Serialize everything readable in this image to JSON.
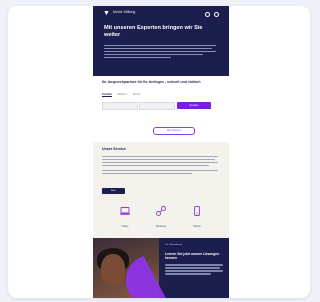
{
  "hero": {
    "title": "Mit unseren Experten bringen wir Sie weiter",
    "logo": "Moritz Stiftung"
  },
  "form": {
    "title": "Ihr Ansprechpartner für Ihr Anliegen - schnell und einfach",
    "tabs": [
      "Kontakt",
      "Rückruf",
      "Termin"
    ],
    "submit_label": "Senden",
    "more_label": "Alle Optionen"
  },
  "info": {
    "title": "Unser Service",
    "button_label": "Mehr",
    "features": [
      {
        "icon": "laptop-icon",
        "label": "Online"
      },
      {
        "icon": "network-icon",
        "label": "Beratung"
      },
      {
        "icon": "phone-icon",
        "label": "Telefon"
      }
    ]
  },
  "promo": {
    "kicker": "Für Unternehmen",
    "title": "Lernen Sie jetzt unsere Lösungen kennen"
  },
  "colors": {
    "navy": "#1c1f4e",
    "accent": "#7d1fd8",
    "sand": "#f4f2ec"
  }
}
